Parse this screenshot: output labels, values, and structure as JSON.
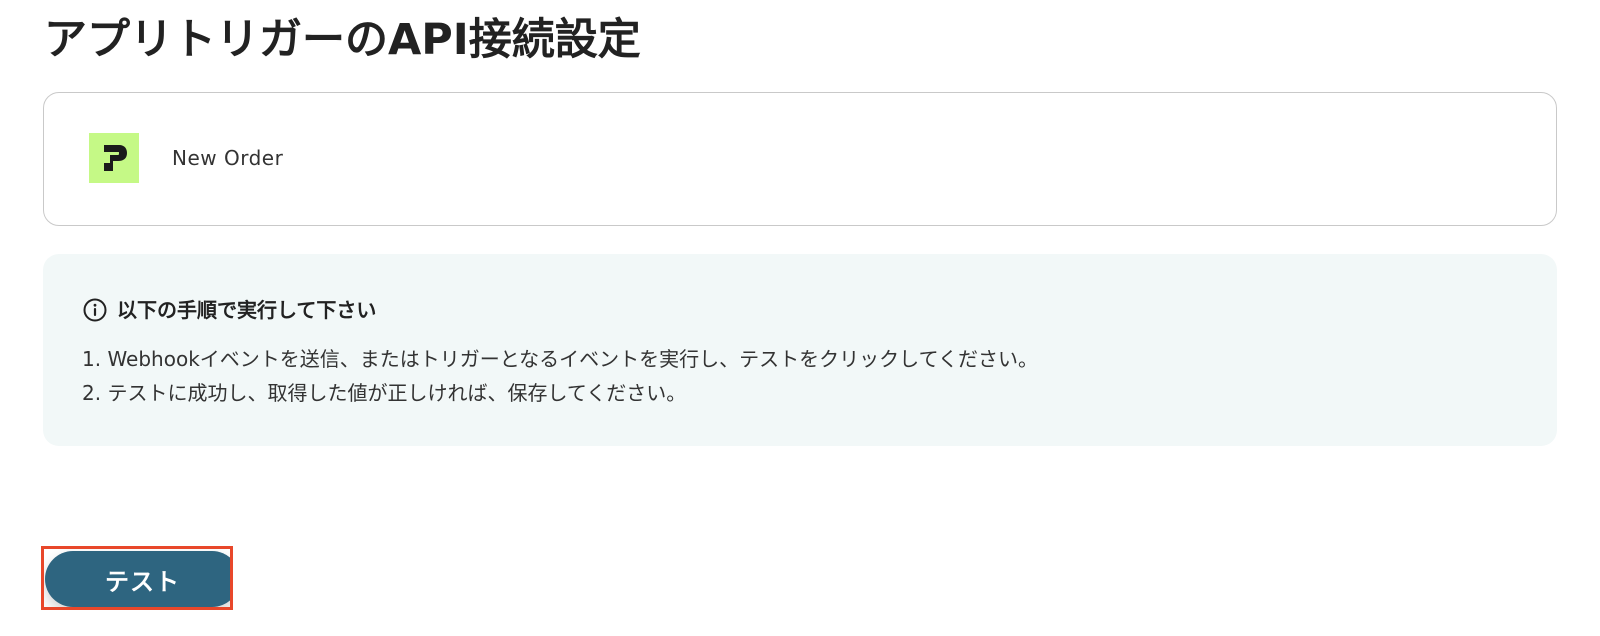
{
  "page": {
    "title": "アプリトリガーのAPI接続設定"
  },
  "app_card": {
    "logo_icon": "app-logo-icon",
    "logo_color": "#c5f986",
    "event_name": "New Order"
  },
  "info_panel": {
    "icon": "info-icon",
    "heading": "以下の手順で実行して下さい",
    "steps": [
      "1. Webhookイベントを送信、またはトリガーとなるイベントを実行し、テストをクリックしてください。",
      "2. テストに成功し、取得した値が正しければ、保存してください。"
    ],
    "background": "#f2f8f8"
  },
  "actions": {
    "test_label": "テスト",
    "test_color": "#2e6580",
    "highlight_color": "#e8472a"
  }
}
